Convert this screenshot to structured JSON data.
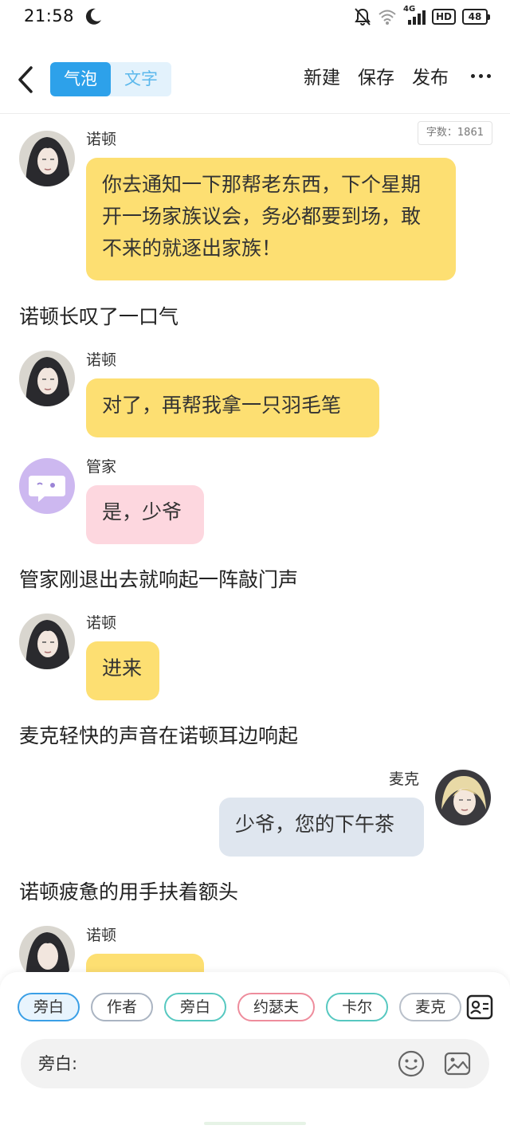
{
  "status": {
    "time": "21:58",
    "network": "4G",
    "hd": "HD",
    "battery": "48"
  },
  "header": {
    "toggle": [
      "气泡",
      "文字"
    ],
    "actions": {
      "new": "新建",
      "save": "保存",
      "publish": "发布"
    }
  },
  "word_count": "字数：1861",
  "messages": [
    {
      "speaker": "诺顿",
      "text": "你去通知一下那帮老东西，下个星期开一场家族议会，务必都要到场，敢不来的就逐出家族！"
    },
    {
      "narration": "诺顿长叹了一口气"
    },
    {
      "speaker": "诺顿",
      "text": "对了，再帮我拿一只羽毛笔"
    },
    {
      "speaker": "管家",
      "text": "是，少爷"
    },
    {
      "narration": "管家刚退出去就响起一阵敲门声"
    },
    {
      "speaker": "诺顿",
      "text": "进来"
    },
    {
      "narration": "麦克轻快的声音在诺顿耳边响起"
    },
    {
      "speaker": "麦克",
      "text": "少爷，您的下午茶"
    },
    {
      "narration": "诺顿疲惫的用手扶着额头"
    },
    {
      "speaker": "诺顿",
      "text": ""
    }
  ],
  "colors": {
    "accent": "#2da1ea",
    "bubble_yellow": "#fddf72",
    "bubble_pink": "#fdd7df",
    "bubble_blue": "#dfe6ef"
  },
  "composer": {
    "chips": [
      "旁白",
      "作者",
      "旁白",
      "约瑟夫",
      "卡尔",
      "麦克"
    ],
    "selected_chip": "旁白",
    "prefix": "旁白:",
    "input_value": "",
    "icons": [
      "contact-card-icon",
      "emoji-icon",
      "image-icon"
    ]
  }
}
